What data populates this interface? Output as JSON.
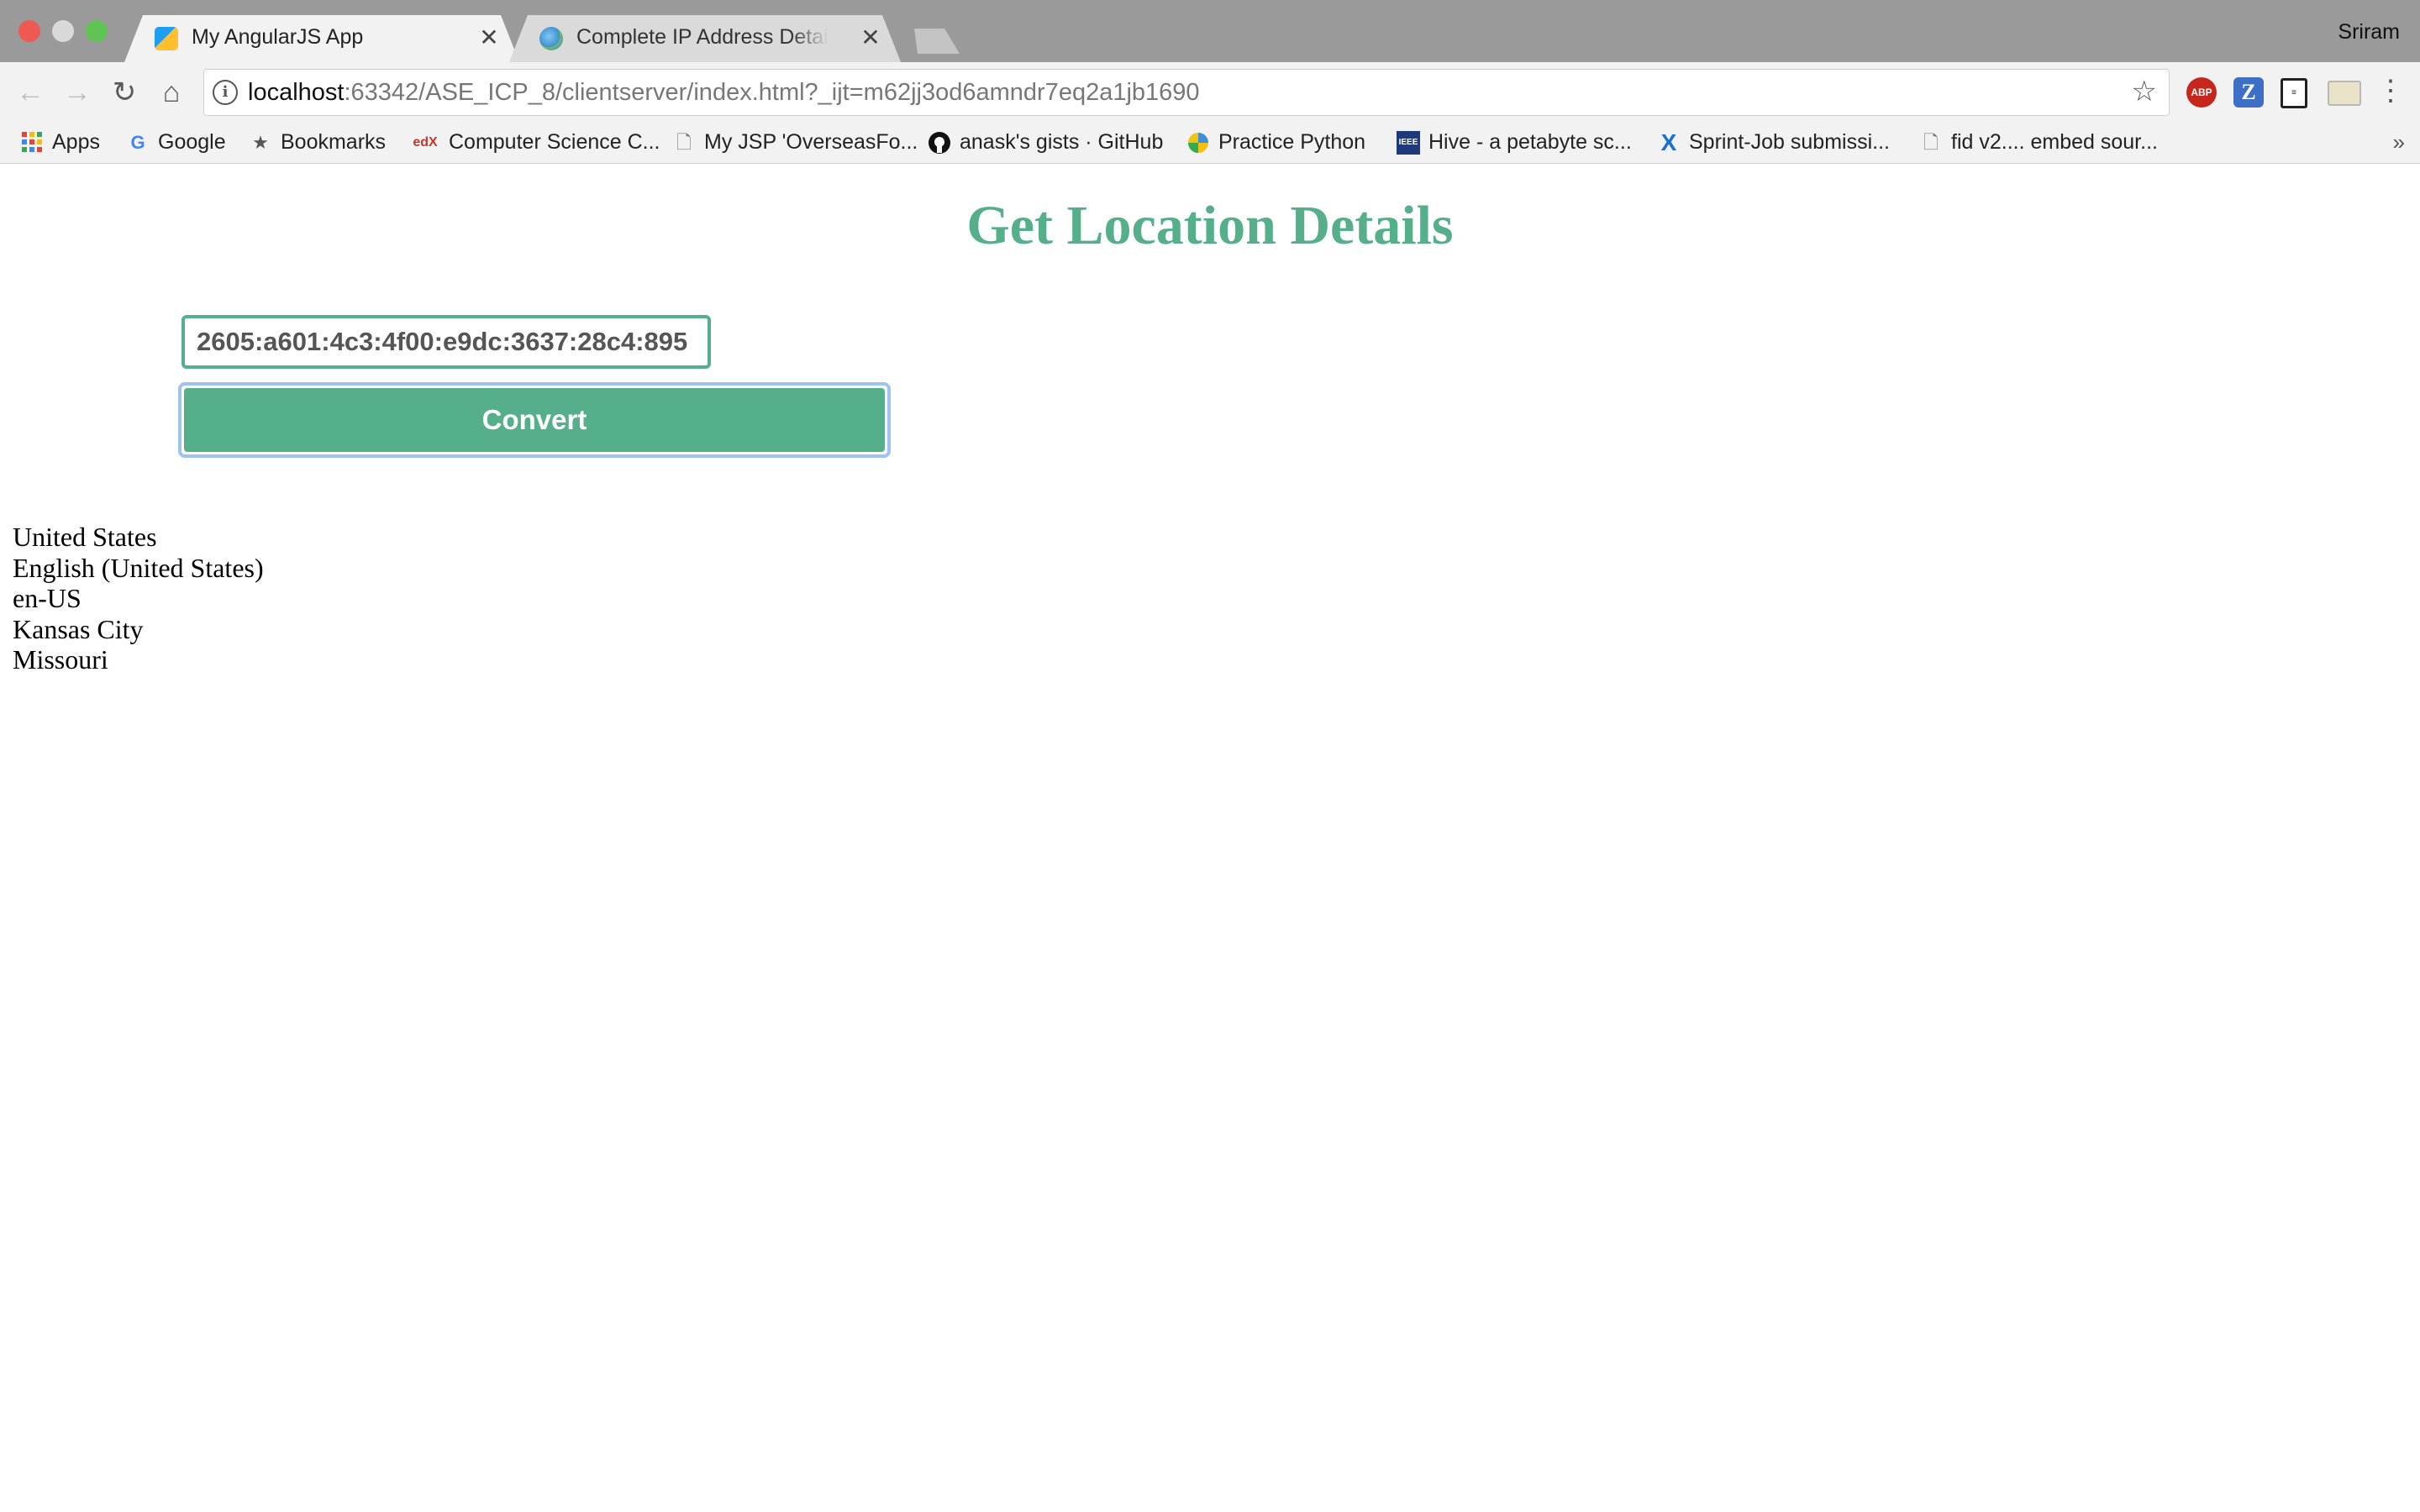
{
  "browser": {
    "tabs": [
      {
        "title": "My AngularJS App",
        "favicon": "webstorm-icon",
        "active": true
      },
      {
        "title": "Complete IP Address Details fo",
        "favicon": "globe-icon",
        "active": false
      }
    ],
    "close_glyph": "✕",
    "profile": "Sriram",
    "url_host": "localhost",
    "url_rest": ":63342/ASE_ICP_8/clientserver/index.html?_ijt=m62jj3od6amndr7eq2a1jb1690",
    "bookmarks": [
      {
        "label": "Apps",
        "icon": "apps-grid-icon"
      },
      {
        "label": "Google",
        "icon": "google-icon"
      },
      {
        "label": "Bookmarks",
        "icon": "star-icon"
      },
      {
        "label": "Computer Science C...",
        "icon": "edx-icon"
      },
      {
        "label": "My JSP 'OverseasFo...",
        "icon": "page-icon"
      },
      {
        "label": "anask's gists · GitHub",
        "icon": "github-icon"
      },
      {
        "label": "Practice Python",
        "icon": "practice-python-icon"
      },
      {
        "label": "Hive - a petabyte sc...",
        "icon": "ieee-icon"
      },
      {
        "label": "Sprint-Job submissi...",
        "icon": "x-icon"
      },
      {
        "label": "fid v2.... embed sour...",
        "icon": "page-icon"
      }
    ],
    "bookmarks_overflow": "»"
  },
  "app": {
    "heading": "Get Location Details",
    "ip_value": "2605:a601:4c3:4f00:e9dc:3637:28c4:895",
    "convert_label": "Convert",
    "results": {
      "country": "United States",
      "language": "English (United States)",
      "locale": "en-US",
      "city": "Kansas City",
      "region": "Missouri"
    }
  },
  "colors": {
    "accent": "#55af8a",
    "focus_ring": "#9ec3f0"
  }
}
